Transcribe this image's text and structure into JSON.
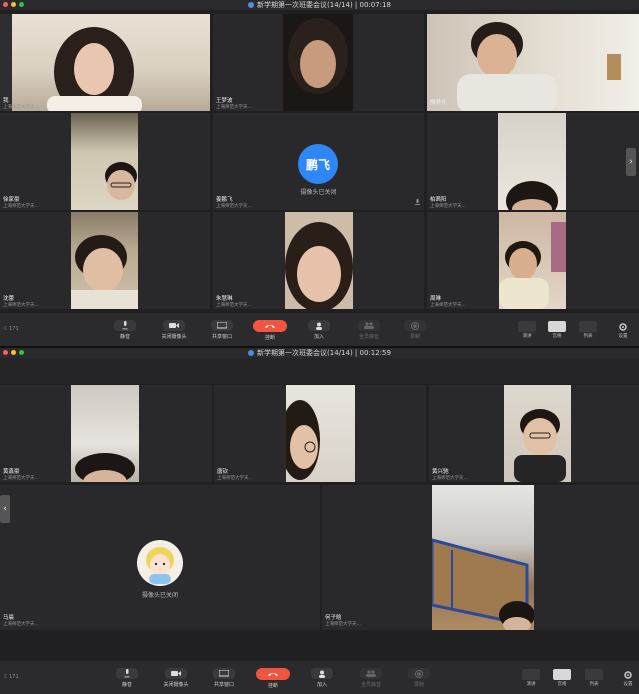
{
  "top_window": {
    "title": "新学期第一次班委会议(14/14) | 00:07:18",
    "participants": [
      {
        "name": "我",
        "org": "上海师范大学天..."
      },
      {
        "name": "王梦波",
        "org": "上海师范大学天..."
      },
      {
        "name": "殷养凡",
        "org": ""
      },
      {
        "name": "徐家豪",
        "org": "上海师范大学天..."
      },
      {
        "name": "姜鹏飞",
        "org": "上海师范大学天...",
        "avatar_text": "鹏飞",
        "status": "摄像头已关闭"
      },
      {
        "name": "柏茜阳",
        "org": "上海师范大学天..."
      },
      {
        "name": "沈蕾",
        "org": "上海师范大学天..."
      },
      {
        "name": "朱慧琳",
        "org": "上海师范大学天..."
      },
      {
        "name": "周琳",
        "org": "上海师范大学天..."
      }
    ],
    "toolbar": {
      "signal": "ℂ 171",
      "mute": "静音",
      "stop_video": "关闭摄像头",
      "share": "共享窗口",
      "hangup": "挂断",
      "invite": "加入",
      "mute_all": "全员静音",
      "record": "录制",
      "speaker_view": "演讲",
      "gallery_view": "宫格",
      "list_view": "列表",
      "settings": "设置"
    }
  },
  "bottom_window": {
    "title": "新学期第一次班委会议(14/14) | 00:12:59",
    "participants": [
      {
        "name": "黄鑫豪",
        "org": "上海师范大学天..."
      },
      {
        "name": "唐钦",
        "org": "上海师范大学天..."
      },
      {
        "name": "黄兴驰",
        "org": "上海师范大学天..."
      },
      {
        "name": "马晨",
        "org": "上海师范大学天...",
        "status": "摄像头已关闭"
      },
      {
        "name": "何子晗",
        "org": "上海师范大学天..."
      }
    ],
    "toolbar": {
      "signal": "ℂ 171",
      "mute": "静音",
      "stop_video": "关闭摄像头",
      "share": "共享窗口",
      "hangup": "挂断",
      "invite": "加入",
      "mute_all": "全员静音",
      "record": "录制",
      "speaker_view": "演讲",
      "gallery_view": "宫格",
      "list_view": "列表",
      "settings": "设置"
    }
  },
  "colors": {
    "avatar_blue": "#2f86f6",
    "hangup_red": "#f0553f",
    "background": "#202022"
  }
}
